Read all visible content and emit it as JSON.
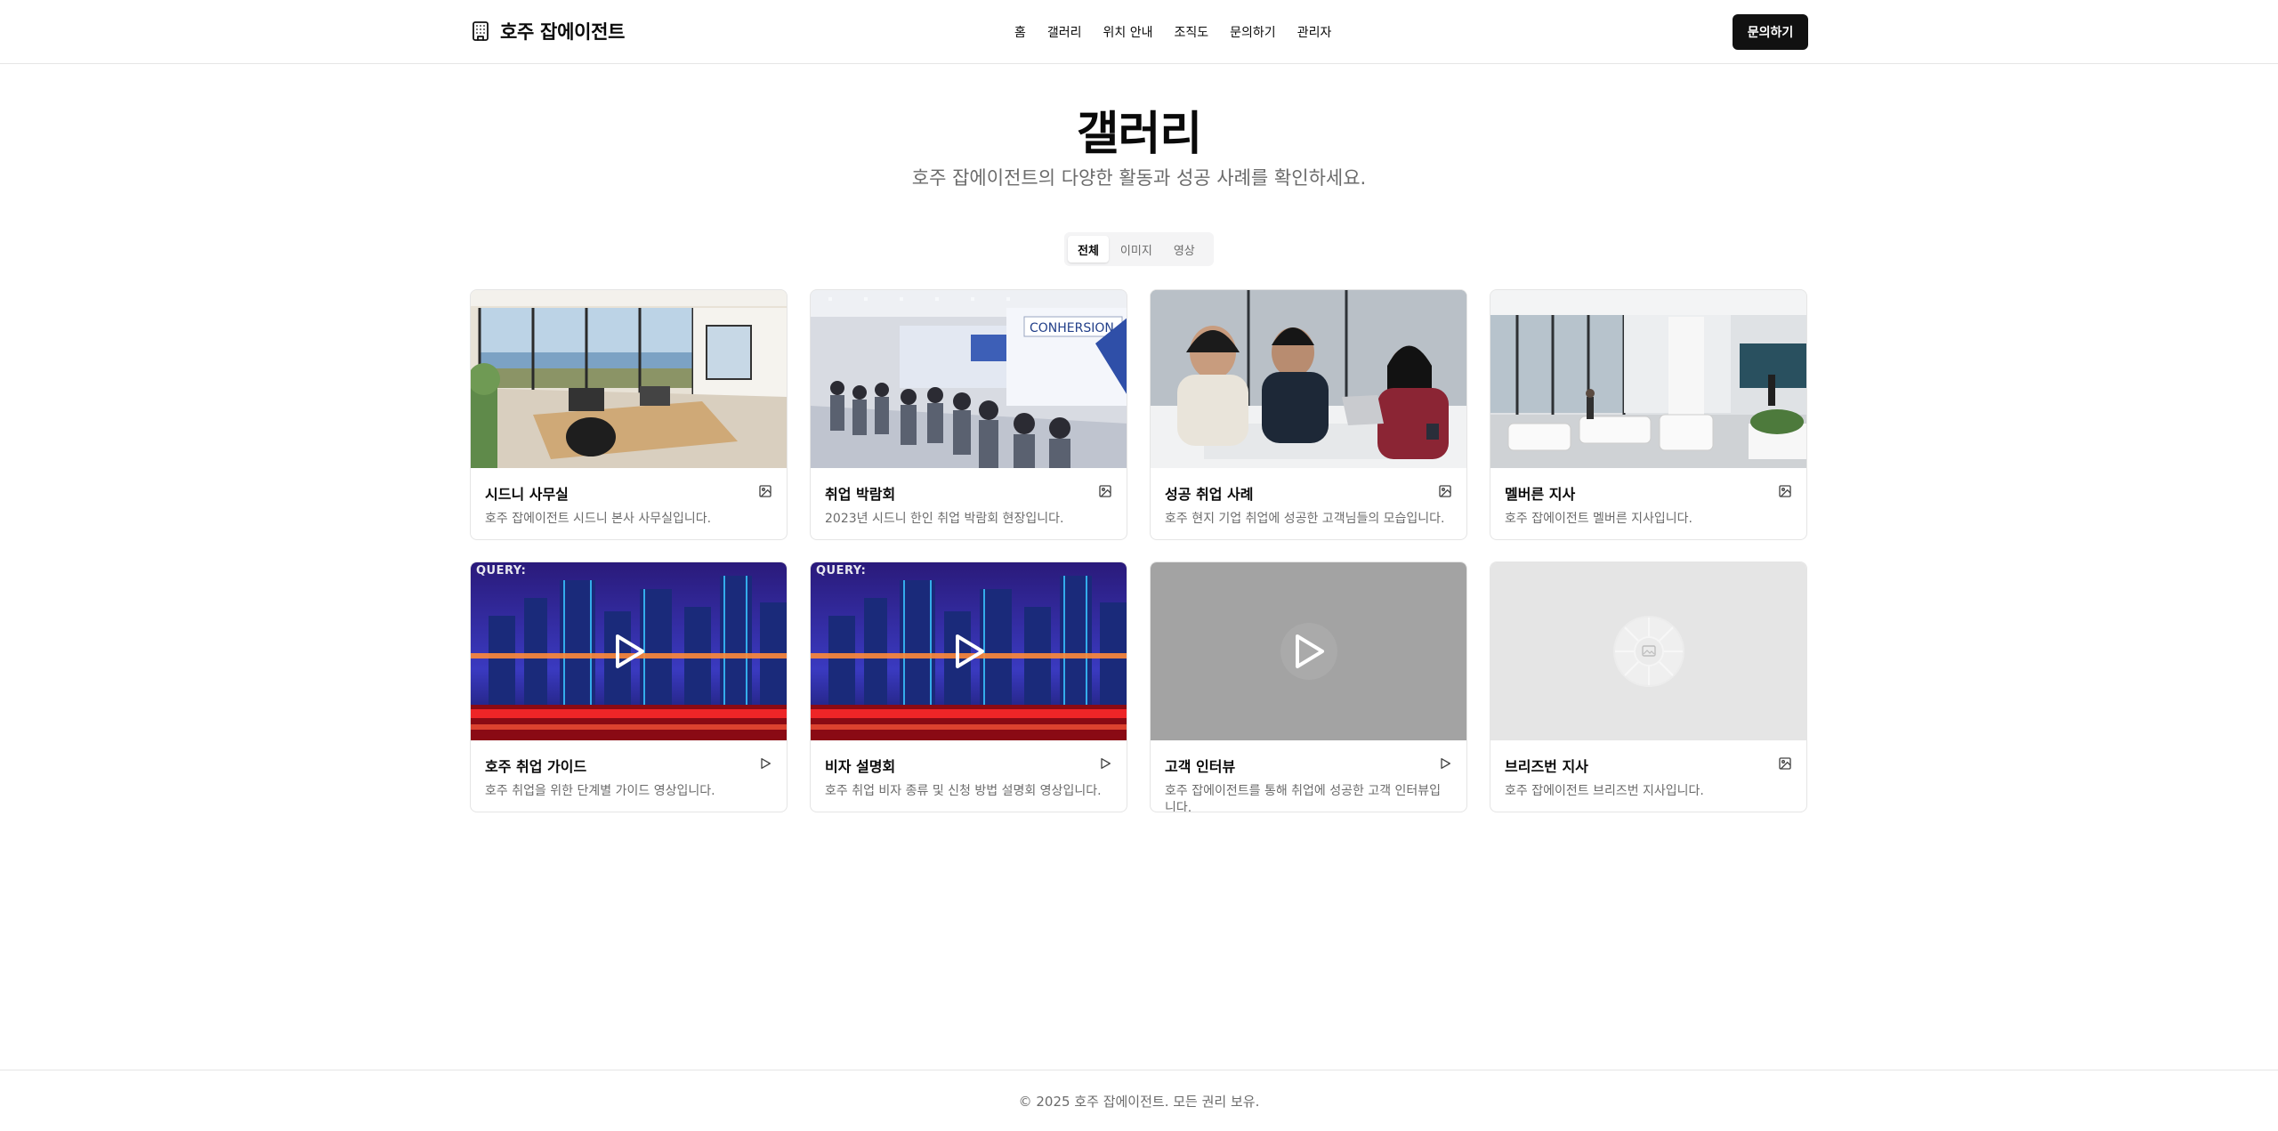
{
  "header": {
    "brand": "호주 잡에이전트",
    "nav": [
      "홈",
      "갤러리",
      "위치 안내",
      "조직도",
      "문의하기",
      "관리자"
    ],
    "cta_label": "문의하기"
  },
  "page": {
    "title": "갤러리",
    "subtitle": "호주 잡에이전트의 다양한 활동과 성공 사례를 확인하세요."
  },
  "tabs": [
    {
      "label": "전체",
      "active": true
    },
    {
      "label": "이미지",
      "active": false
    },
    {
      "label": "영상",
      "active": false
    }
  ],
  "gallery": [
    {
      "title": "시드니 사무실",
      "desc": "호주 잡에이전트 시드니 본사 사무실입니다.",
      "type": "image",
      "thumb": "office-photo"
    },
    {
      "title": "취업 박람회",
      "desc": "2023년 시드니 한인 취업 박람회 현장입니다.",
      "type": "image",
      "thumb": "job-fair-photo",
      "sign": "CONHERSION"
    },
    {
      "title": "성공 취업 사례",
      "desc": "호주 현지 기업 취업에 성공한 고객님들의 모습입니다.",
      "type": "image",
      "thumb": "meeting-photo"
    },
    {
      "title": "멜버른 지사",
      "desc": "호주 잡에이전트 멜버른 지사입니다.",
      "type": "image",
      "thumb": "lobby-photo"
    },
    {
      "title": "호주 취업 가이드",
      "desc": "호주 취업을 위한 단계별 가이드 영상입니다.",
      "type": "video",
      "thumb": "city-night-video",
      "tag": "QUERY:"
    },
    {
      "title": "비자 설명회",
      "desc": "호주 취업 비자 종류 및 신청 방법 설명회 영상입니다.",
      "type": "video",
      "thumb": "city-night-video",
      "tag": "QUERY:"
    },
    {
      "title": "고객 인터뷰",
      "desc": "호주 잡에이전트를 통해 취업에 성공한 고객 인터뷰입니다.",
      "type": "video",
      "thumb": "grey-video"
    },
    {
      "title": "브리즈번 지사",
      "desc": "호주 잡에이전트 브리즈번 지사입니다.",
      "type": "image",
      "thumb": "placeholder"
    }
  ],
  "footer": {
    "copyright": "© 2025 호주 잡에이전트. 모든 권리 보유."
  },
  "colors": {
    "primary": "#111111",
    "muted_text": "#6b6b6b",
    "border": "#e5e5e5",
    "tab_bg": "#f4f4f5"
  }
}
